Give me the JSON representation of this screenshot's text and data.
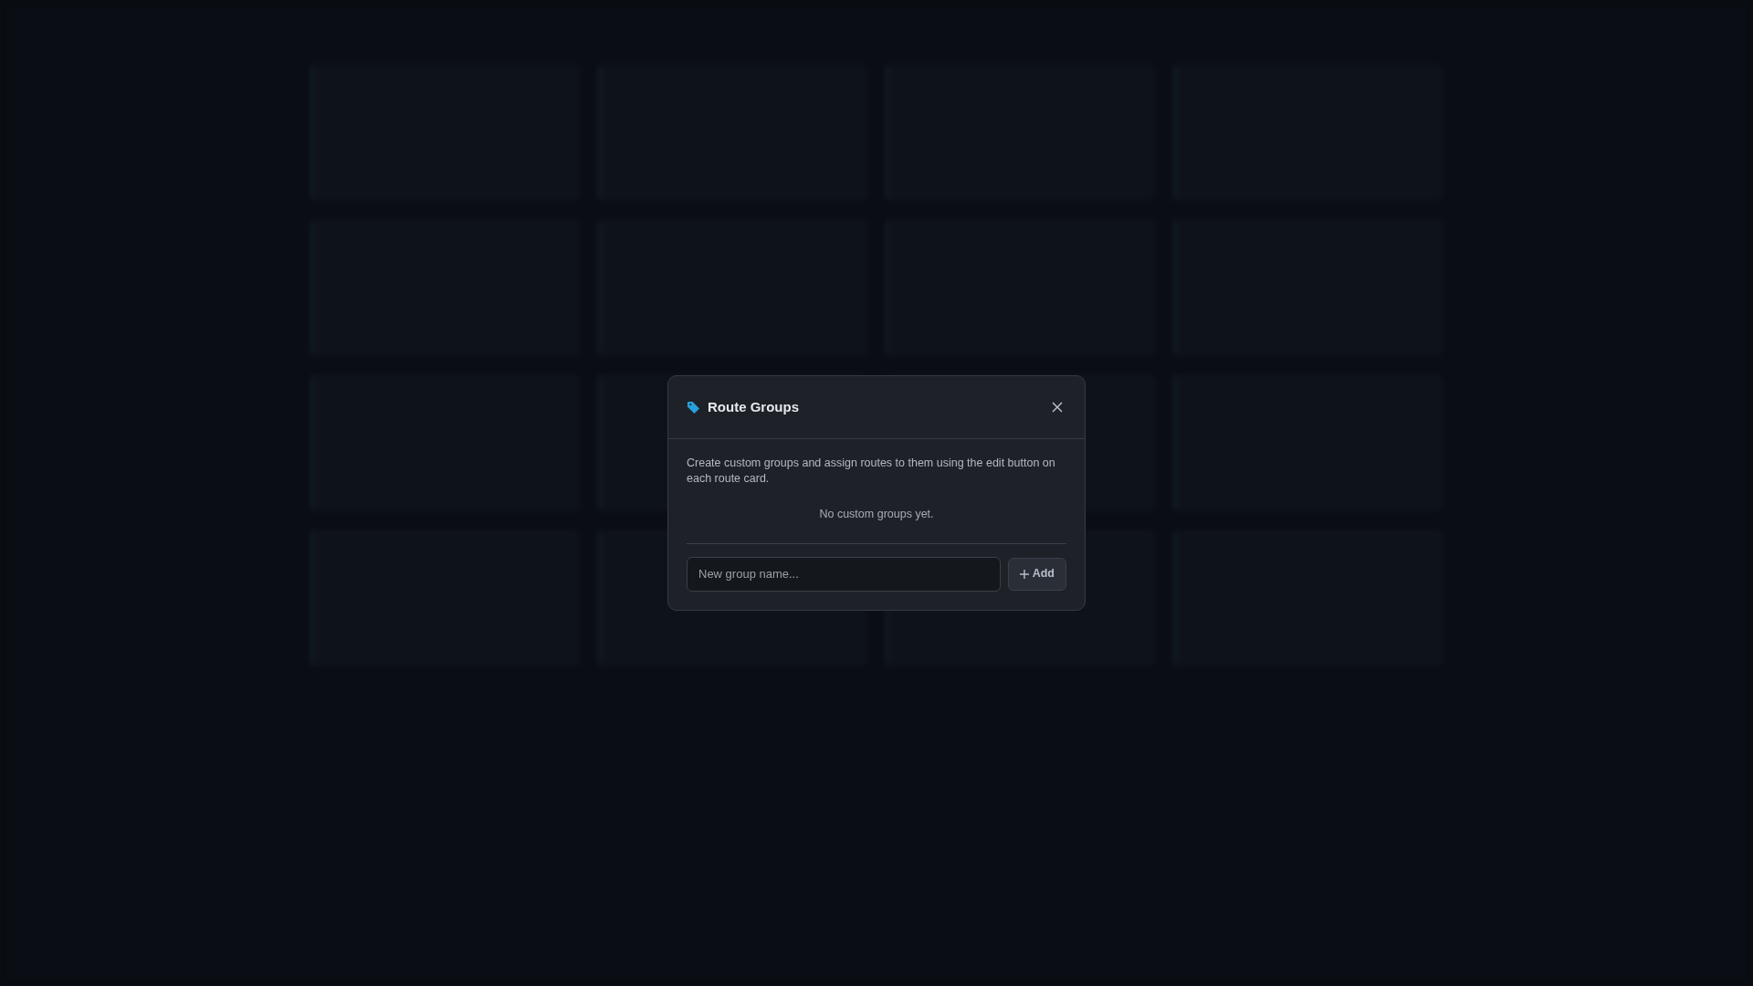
{
  "dialog": {
    "title": "Route Groups",
    "description": "Create custom groups and assign routes to them using the edit button on each route card.",
    "empty_message": "No custom groups yet.",
    "new_group_field": {
      "placeholder": "New group name..."
    },
    "add_button": {
      "label": "Add"
    }
  }
}
